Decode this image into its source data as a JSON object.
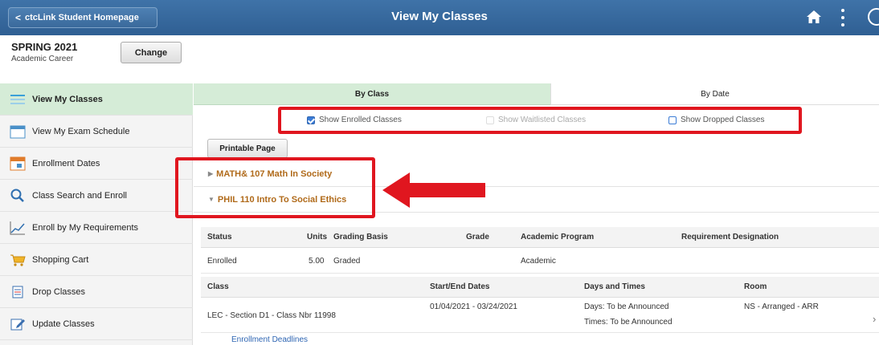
{
  "header": {
    "back_label": "ctcLink Student Homepage",
    "title": "View My Classes",
    "home_icon": "home-icon",
    "more_icon": "more-vertical-icon"
  },
  "term": {
    "name": "SPRING 2021",
    "career": "Academic Career",
    "change_label": "Change"
  },
  "sidebar": {
    "items": [
      {
        "label": "View My Classes",
        "icon": "calendar-list-icon",
        "active": true
      },
      {
        "label": "View My Exam Schedule",
        "icon": "calendar-icon",
        "active": false
      },
      {
        "label": "Enrollment Dates",
        "icon": "calendar-date-icon",
        "active": false
      },
      {
        "label": "Class Search and Enroll",
        "icon": "search-icon",
        "active": false
      },
      {
        "label": "Enroll by My Requirements",
        "icon": "chart-line-icon",
        "active": false
      },
      {
        "label": "Shopping Cart",
        "icon": "shopping-cart-icon",
        "active": false
      },
      {
        "label": "Drop Classes",
        "icon": "drop-list-icon",
        "active": false
      },
      {
        "label": "Update Classes",
        "icon": "edit-icon",
        "active": false
      }
    ]
  },
  "tabs": {
    "by_class": "By Class",
    "by_date": "By Date"
  },
  "filters": {
    "enrolled": "Show Enrolled Classes",
    "waitlisted": "Show Waitlisted Classes",
    "dropped": "Show Dropped Classes"
  },
  "printable_label": "Printable Page",
  "courses": [
    {
      "title": "MATH& 107 Math In Society",
      "expanded": false
    },
    {
      "title": "PHIL 110 Intro To Social Ethics",
      "expanded": true
    }
  ],
  "status_table": {
    "headers": [
      "Status",
      "Units",
      "Grading Basis",
      "Grade",
      "Academic Program",
      "Requirement Designation"
    ],
    "row": {
      "status": "Enrolled",
      "units": "5.00",
      "grading": "Graded",
      "grade": "",
      "program": "Academic",
      "requirement": ""
    }
  },
  "class_table": {
    "headers": [
      "Class",
      "Start/End Dates",
      "Days and Times",
      "Room"
    ],
    "row": {
      "class": "LEC - Section D1 - Class Nbr 11998",
      "dates": "01/04/2021 - 03/24/2021",
      "days": "Days: To be Announced",
      "times": "Times: To be Announced",
      "room": "NS - Arranged - ARR"
    }
  },
  "enrollment_deadlines_link": "Enrollment Deadlines",
  "colors": {
    "header_blue": "#2f5f93",
    "active_green": "#d5ecd7",
    "highlight_red": "#e0161f",
    "course_link": "#b06a1a"
  }
}
